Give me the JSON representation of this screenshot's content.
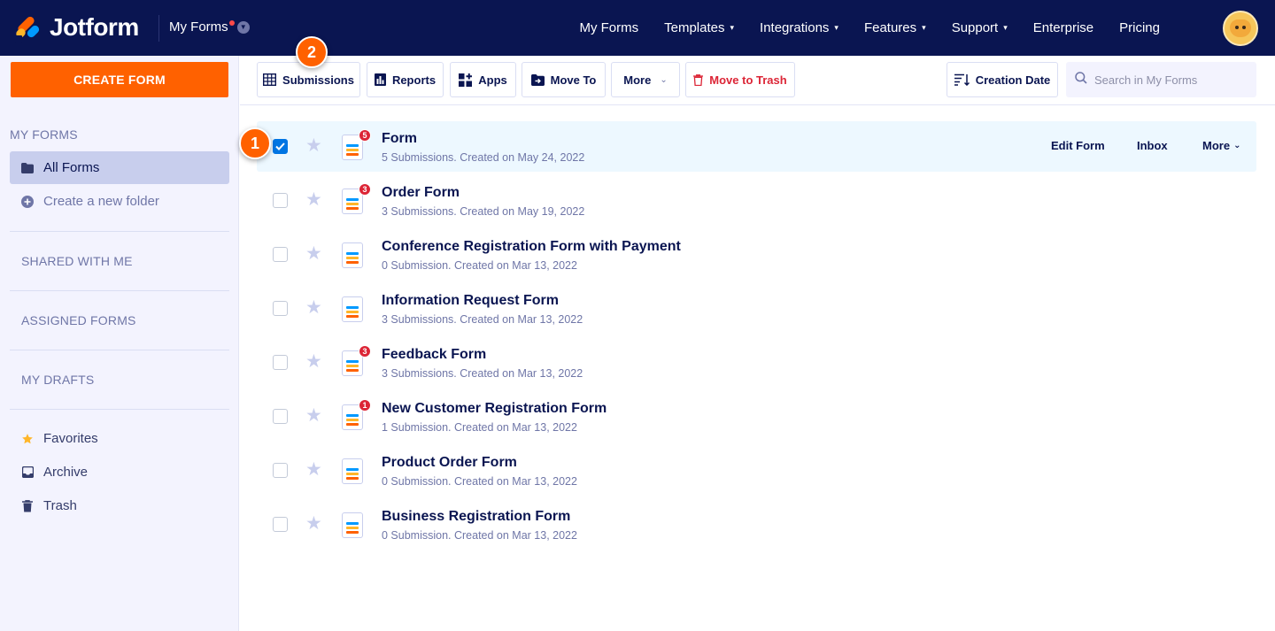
{
  "brand": {
    "name": "Jotform"
  },
  "topbar": {
    "myforms_label": "My Forms",
    "nav": [
      {
        "label": "My Forms",
        "caret": false
      },
      {
        "label": "Templates",
        "caret": true
      },
      {
        "label": "Integrations",
        "caret": true
      },
      {
        "label": "Features",
        "caret": true
      },
      {
        "label": "Support",
        "caret": true
      },
      {
        "label": "Enterprise",
        "caret": false
      },
      {
        "label": "Pricing",
        "caret": false
      }
    ]
  },
  "sidebar": {
    "create_label": "CREATE FORM",
    "my_forms_heading": "MY FORMS",
    "all_forms": "All Forms",
    "create_folder": "Create a new folder",
    "shared": "SHARED WITH ME",
    "assigned": "ASSIGNED FORMS",
    "drafts": "MY DRAFTS",
    "favorites": "Favorites",
    "archive": "Archive",
    "trash": "Trash"
  },
  "toolbar": {
    "submissions": "Submissions",
    "reports": "Reports",
    "apps": "Apps",
    "move_to": "Move To",
    "more": "More",
    "move_to_trash": "Move to Trash",
    "sort": "Creation Date",
    "search_placeholder": "Search in My Forms"
  },
  "row_actions": {
    "edit": "Edit Form",
    "inbox": "Inbox",
    "more": "More"
  },
  "forms": [
    {
      "title": "Form",
      "subtitle": "5 Submissions. Created on May 24, 2022",
      "badge": "5",
      "checked": true
    },
    {
      "title": "Order Form",
      "subtitle": "3 Submissions. Created on May 19, 2022",
      "badge": "3",
      "checked": false
    },
    {
      "title": "Conference Registration Form with Payment",
      "subtitle": "0 Submission. Created on Mar 13, 2022",
      "badge": "",
      "checked": false
    },
    {
      "title": "Information Request Form",
      "subtitle": "3 Submissions. Created on Mar 13, 2022",
      "badge": "",
      "checked": false
    },
    {
      "title": "Feedback Form",
      "subtitle": "3 Submissions. Created on Mar 13, 2022",
      "badge": "3",
      "checked": false
    },
    {
      "title": "New Customer Registration Form",
      "subtitle": "1 Submission. Created on Mar 13, 2022",
      "badge": "1",
      "checked": false
    },
    {
      "title": "Product Order Form",
      "subtitle": "0 Submission. Created on Mar 13, 2022",
      "badge": "",
      "checked": false
    },
    {
      "title": "Business Registration Form",
      "subtitle": "0 Submission. Created on Mar 13, 2022",
      "badge": "",
      "checked": false
    }
  ],
  "callouts": {
    "first": "1",
    "second": "2"
  },
  "colors": {
    "navy": "#0a1551",
    "orange": "#ff6100",
    "blue": "#0075e3",
    "red": "#dc2536",
    "sidebar_bg": "#f3f3fe"
  }
}
